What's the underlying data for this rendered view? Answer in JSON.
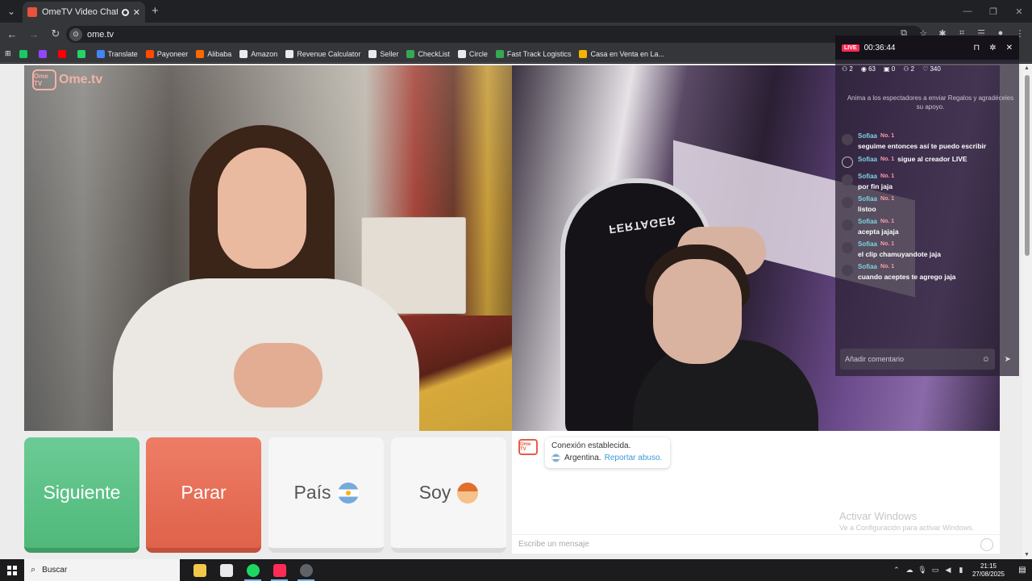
{
  "browser": {
    "tab_title": "OmeTV Video Chat — Online",
    "url": "ome.tv",
    "site_badge": "⊙",
    "bookmarks": [
      {
        "label": "",
        "color": "#17c964"
      },
      {
        "label": "",
        "color": "#9146ff"
      },
      {
        "label": "",
        "color": "#ff0000"
      },
      {
        "label": "",
        "color": "#25d366"
      },
      {
        "label": "Translate",
        "color": "#4285f4"
      },
      {
        "label": "Payoneer",
        "color": "#ff4800"
      },
      {
        "label": "Alibaba",
        "color": "#ff6a00"
      },
      {
        "label": "Amazon",
        "color": "#e8eaed"
      },
      {
        "label": "Revenue Calculator",
        "color": "#e8eaed"
      },
      {
        "label": "Seller",
        "color": "#e8eaed"
      },
      {
        "label": "CheckList",
        "color": "#34a853"
      },
      {
        "label": "Circle",
        "color": "#e8eaed"
      },
      {
        "label": "Fast Track Logistics",
        "color": "#34a853"
      },
      {
        "label": "Casa en Venta en La...",
        "color": "#f4b400"
      }
    ]
  },
  "site": {
    "logo_text": "Ome.tv",
    "logo_box": "Ome TV"
  },
  "live": {
    "badge": "LIVE",
    "timer": "00:36:44",
    "stats": {
      "guests": "2",
      "viewers": "63",
      "gifts": "0",
      "joined": "2",
      "likes": "340"
    },
    "note": "Anima a los espectadores a enviar Regalos y agradéceles su apoyo.",
    "messages": [
      {
        "user": "Sofiaa",
        "rank": "No. 1",
        "text": "seguime entonces así te puedo escribir",
        "inline": false
      },
      {
        "user": "Sofiaa",
        "rank": "No. 1",
        "text": "sigue al creador LIVE",
        "inline": true
      },
      {
        "user": "Sofiaa",
        "rank": "No. 1",
        "text": "por fin jaja",
        "inline": false
      },
      {
        "user": "Sofiaa",
        "rank": "No. 1",
        "text": "listoo",
        "inline": false
      },
      {
        "user": "Sofiaa",
        "rank": "No. 1",
        "text": "acepta jajaja",
        "inline": false
      },
      {
        "user": "Sofiaa",
        "rank": "No. 1",
        "text": "el clip chamuyandote jaja",
        "inline": false
      },
      {
        "user": "Sofiaa",
        "rank": "No. 1",
        "text": "cuando aceptes te agrego jaja",
        "inline": false
      }
    ],
    "comment_placeholder": "Añadir comentario"
  },
  "video_right": {
    "chair_text": "FERTAGER"
  },
  "controls": {
    "next": "Siguiente",
    "stop": "Parar",
    "country": "País",
    "gender": "Soy"
  },
  "chat": {
    "icon_text": "Ome TV",
    "connected": "Conexión establecida.",
    "country": "Argentina.",
    "report": "Reportar abuso.",
    "placeholder": "Escribe un mensaje",
    "activate_title": "Activar Windows",
    "activate_sub": "Ve a Configuración para activar Windows."
  },
  "taskbar": {
    "search_label": "Buscar",
    "time": "21:15",
    "date": "27/08/2025"
  }
}
